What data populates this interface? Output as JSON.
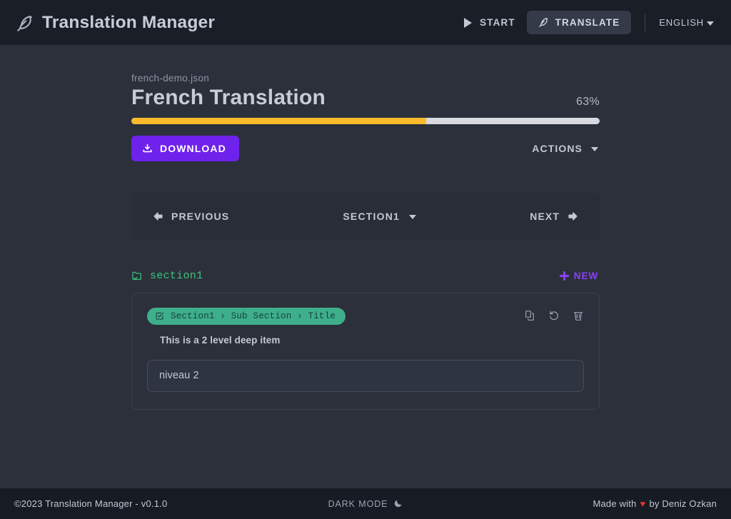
{
  "header": {
    "brand_icon": "feather-icon",
    "brand_title": "Translation Manager",
    "start_label": "START",
    "start_icon": "play-icon",
    "translate_label": "TRANSLATE",
    "translate_icon": "feather-icon",
    "language_label": "ENGLISH",
    "language_caret_icon": "chevron-down-icon"
  },
  "document": {
    "file_name": "french-demo.json",
    "title": "French Translation",
    "progress_percent_label": "63%",
    "progress_percent": 63,
    "progress_fill_color": "#fcbb2b",
    "progress_track_color": "#d8dae0",
    "download_label": "DOWNLOAD",
    "download_icon": "download-icon",
    "download_color": "#6f22ec",
    "actions_label": "ACTIONS",
    "actions_caret_icon": "chevron-down-icon"
  },
  "nav": {
    "previous_label": "PREVIOUS",
    "previous_icon": "arrow-left-icon",
    "section_label": "SECTION1",
    "section_caret_icon": "chevron-down-icon",
    "next_label": "NEXT",
    "next_icon": "arrow-right-icon"
  },
  "section": {
    "folder_icon": "folder-check-icon",
    "name": "section1",
    "name_color": "#3dc97f",
    "new_label": "NEW",
    "new_icon": "plus-icon",
    "new_color": "#8b3ff5"
  },
  "entry": {
    "badge_icon": "checkbox-icon",
    "badge_text": "Section1 › Sub Section › Title",
    "badge_color": "#3fae8b",
    "description": "This is a 2 level deep item",
    "value": "niveau 2",
    "placeholder": "",
    "copy_icon": "copy-icon",
    "revert_icon": "undo-icon",
    "delete_icon": "trash-icon"
  },
  "footer": {
    "copyright": "©2023 Translation Manager - v0.1.0",
    "dark_mode_label": "DARK MODE",
    "dark_mode_icon": "moon-icon",
    "credit_prefix": "Made with",
    "credit_heart": "♥",
    "credit_suffix": "by Deniz Ozkan",
    "heart_color": "#e3342f"
  }
}
